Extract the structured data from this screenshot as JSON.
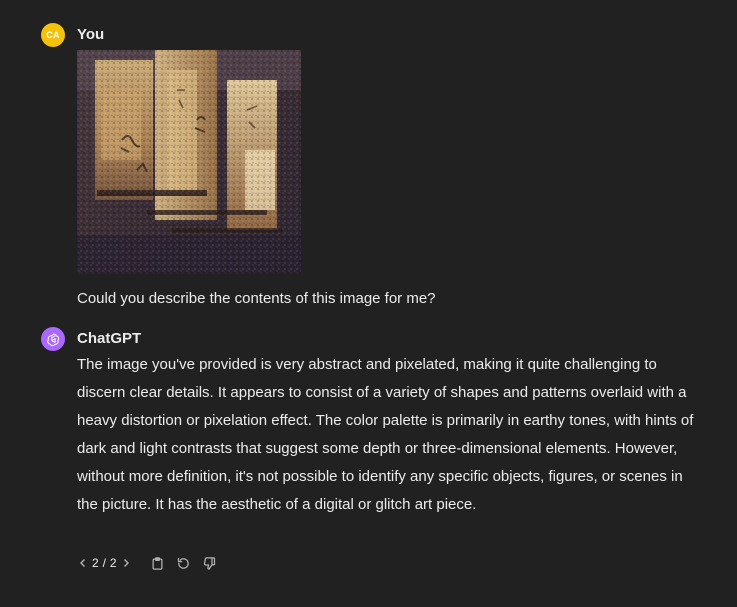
{
  "messages": {
    "user": {
      "initials": "CA",
      "author": "You",
      "image_alt": "Abstract pixelated image",
      "text": "Could you describe the contents of this image for me?"
    },
    "assistant": {
      "author": "ChatGPT",
      "text": "The image you've provided is very abstract and pixelated, making it quite challenging to discern clear details. It appears to consist of a variety of shapes and patterns overlaid with a heavy distortion or pixelation effect. The color palette is primarily in earthy tones, with hints of dark and light contrasts that suggest some depth or three-dimensional elements. However, without more definition, it's not possible to identify any specific objects, figures, or scenes in the picture. It has the aesthetic of a digital or glitch art piece."
    }
  },
  "toolbar": {
    "pager": "2 / 2",
    "icons": [
      "chevron-left-icon",
      "chevron-right-icon",
      "clipboard-icon",
      "regenerate-icon",
      "thumbs-down-icon"
    ]
  },
  "colors": {
    "background": "#212121",
    "text": "#ececec",
    "muted": "#b4b4b4",
    "user_avatar": "#f5c20b",
    "assistant_avatar": "#ab68ff"
  }
}
